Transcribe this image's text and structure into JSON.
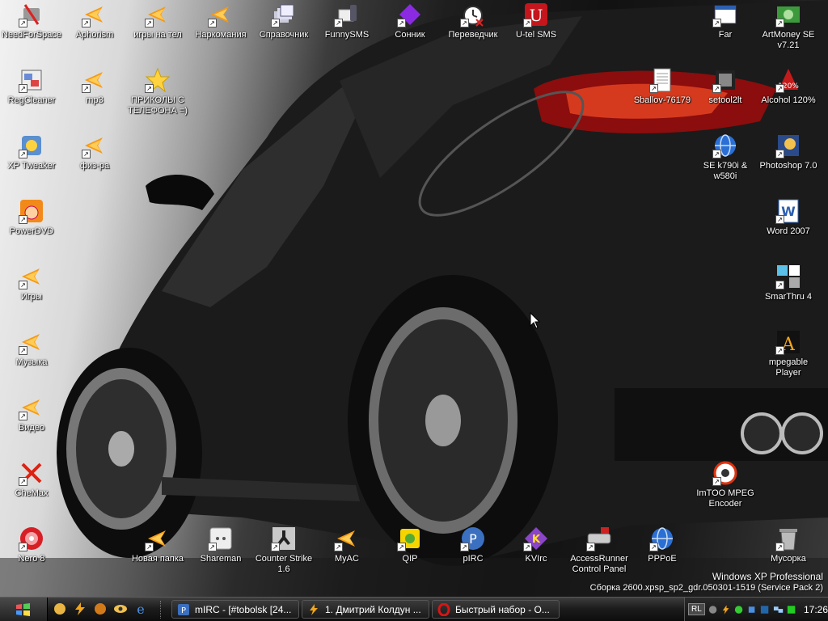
{
  "desktop": {
    "icons": [
      {
        "label": "NeedForSpace",
        "glyph": "tools"
      },
      {
        "label": "Aphorism",
        "glyph": "orange"
      },
      {
        "label": "игры на тел",
        "glyph": "orange"
      },
      {
        "label": "Наркомания",
        "glyph": "orange"
      },
      {
        "label": "Справочник",
        "glyph": "stack"
      },
      {
        "label": "FunnySMS",
        "glyph": "phone"
      },
      {
        "label": "Сонник",
        "glyph": "diamond"
      },
      {
        "label": "Переведчик",
        "glyph": "clock"
      },
      {
        "label": "U-tel SMS",
        "glyph": "utel"
      },
      {
        "label": "Far",
        "glyph": "window"
      },
      {
        "label": "ArtMoney SE v7.21",
        "glyph": "money"
      },
      {
        "label": "RegCleaner",
        "glyph": "reg"
      },
      {
        "label": "mp3",
        "glyph": "orange"
      },
      {
        "label": "ПРИКОЛЫ С ТЕЛЕФОНА =)",
        "glyph": "star"
      },
      {
        "label": "Sballov-76179",
        "glyph": "doc"
      },
      {
        "label": "setool2lt",
        "glyph": "film"
      },
      {
        "label": "Alcohol 120%",
        "glyph": "alcohol"
      },
      {
        "label": "XP Tweaker",
        "glyph": "tweak"
      },
      {
        "label": "физ-ра",
        "glyph": "orange"
      },
      {
        "label": "SE k790i & w580i",
        "glyph": "globe"
      },
      {
        "label": "Photoshop 7.0",
        "glyph": "ps"
      },
      {
        "label": "PowerDVD",
        "glyph": "dvd"
      },
      {
        "label": "Word 2007",
        "glyph": "word"
      },
      {
        "label": "Игры",
        "glyph": "orange"
      },
      {
        "label": "SmarThru 4",
        "glyph": "smart"
      },
      {
        "label": "Музыка",
        "glyph": "orange"
      },
      {
        "label": "mpegable Player",
        "glyph": "mpeg"
      },
      {
        "label": "Видео",
        "glyph": "orange"
      },
      {
        "label": "CheMax",
        "glyph": "cross"
      },
      {
        "label": "ImTOO MPEG Encoder",
        "glyph": "imtoo"
      },
      {
        "label": "Nero 8",
        "glyph": "nero"
      },
      {
        "label": "Новая папка",
        "glyph": "orange"
      },
      {
        "label": "Shareman",
        "glyph": "socket"
      },
      {
        "label": "Counter Strike 1.6",
        "glyph": "cs"
      },
      {
        "label": "MyAC",
        "glyph": "orange"
      },
      {
        "label": "QIP",
        "glyph": "qip"
      },
      {
        "label": "pIRC",
        "glyph": "pirc"
      },
      {
        "label": "KVIrc",
        "glyph": "kvirc"
      },
      {
        "label": "AccessRunner Control Panel",
        "glyph": "access"
      },
      {
        "label": "PPPoE",
        "glyph": "globe"
      },
      {
        "label": "Мусорка",
        "glyph": "trash"
      }
    ]
  },
  "watermark": {
    "line1": "Windows XP Professional",
    "line2": "Сборка 2600.xpsp_sp2_gdr.050301-1519 (Service Pack 2)"
  },
  "taskbar": {
    "quick_launch": [
      "quicklaunch-1-icon",
      "lightning-icon",
      "quicklaunch-3-icon",
      "eye-icon",
      "ie-icon"
    ],
    "buttons": [
      {
        "label": "mIRC - [#tobolsk [24..."
      },
      {
        "label": "1. Дмитрий Колдун ..."
      },
      {
        "label": "Быстрый набор - О..."
      }
    ],
    "tray": {
      "lang": "RL",
      "clock": "17:26"
    }
  }
}
